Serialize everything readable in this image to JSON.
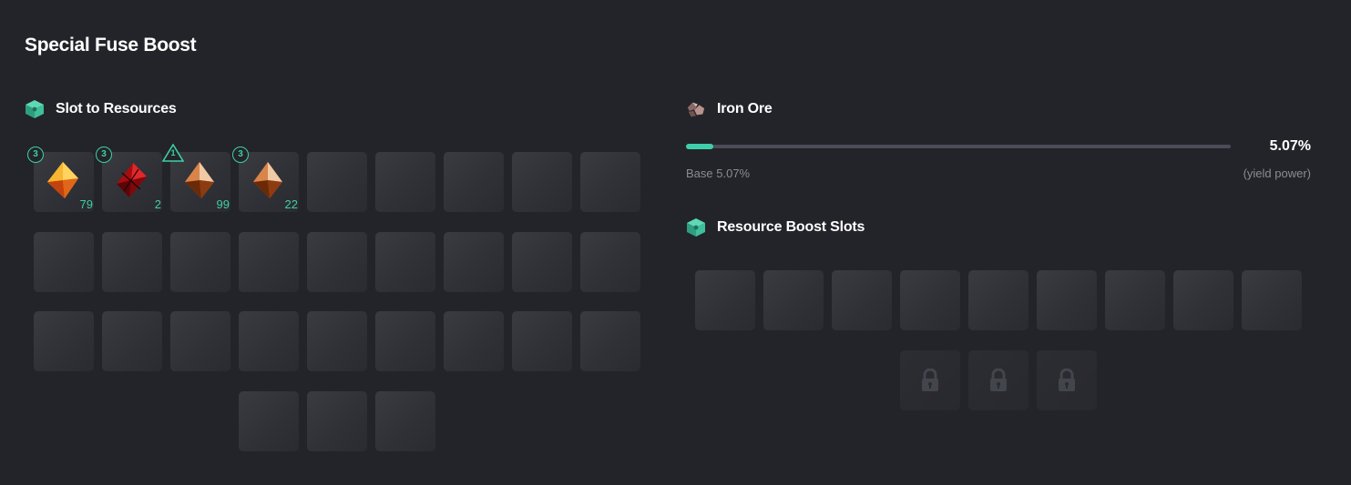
{
  "title": "Special Fuse Boost",
  "slot_section": {
    "label": "Slot to Resources",
    "icon": "cube-icon",
    "items": [
      {
        "badge": "3",
        "badge_type": "circle",
        "gem": "amber-gem",
        "count": "79"
      },
      {
        "badge": "3",
        "badge_type": "circle",
        "gem": "ruby-gem",
        "count": "2"
      },
      {
        "badge": "1",
        "badge_type": "triangle",
        "gem": "copper-gem",
        "count": "99"
      },
      {
        "badge": "3",
        "badge_type": "circle",
        "gem": "copper-gem",
        "count": "22"
      }
    ]
  },
  "resource": {
    "name": "Iron Ore",
    "icon": "iron-ore-icon",
    "percent": "5.07%",
    "progress_fraction": 0.0507,
    "base_label": "Base 5.07%",
    "note": "(yield power)"
  },
  "boost_section": {
    "label": "Resource Boost Slots",
    "icon": "cube-icon"
  },
  "colors": {
    "background": "#232429",
    "accent": "#3ecfaa",
    "slot": "#323339"
  }
}
